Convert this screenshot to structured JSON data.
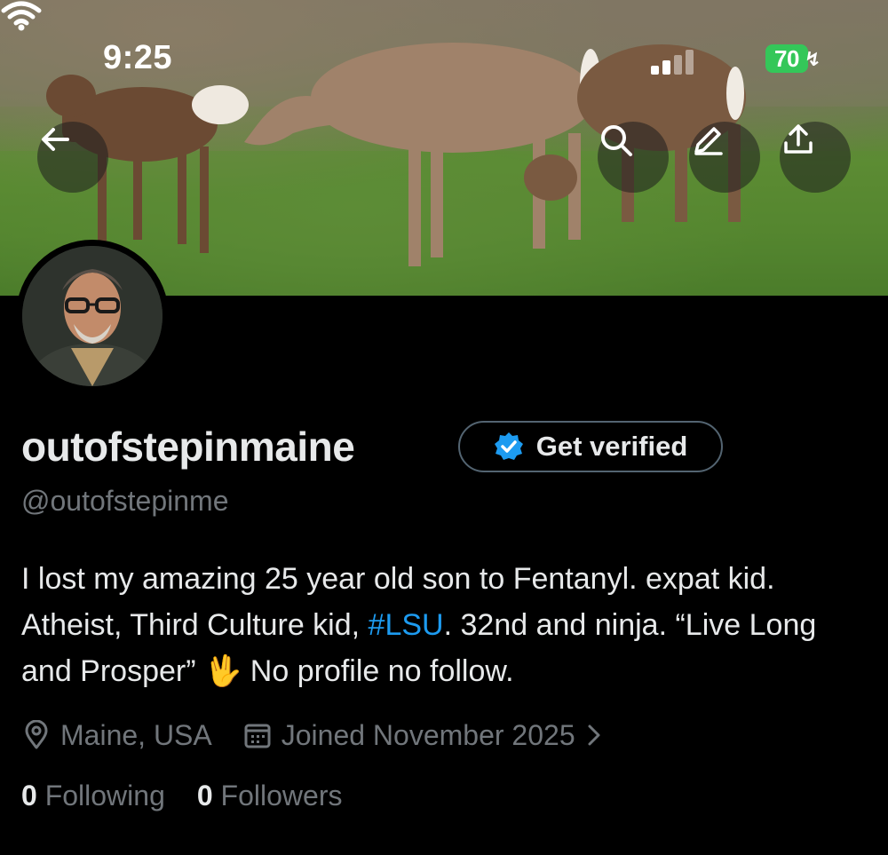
{
  "status_bar": {
    "time": "9:25",
    "battery": "70"
  },
  "header_actions": {
    "back": "arrow-left-icon",
    "search": "search-icon",
    "edit": "pencil-icon",
    "share": "share-icon"
  },
  "profile": {
    "display_name": "outofstepinmaine",
    "verify_button_label": "Get verified",
    "handle": "@outofstepinme",
    "bio": {
      "part1": "I lost my amazing 25 year old son to Fentanyl. expat kid. Atheist, Third Culture kid, ",
      "hashtag": "#LSU",
      "part2": ". 32nd and ninja. “Live Long and Prosper” ",
      "emoji": "🖖",
      "part3": " No profile no follow."
    },
    "location": "Maine, USA",
    "joined": "Joined November 2025",
    "following_count": "0",
    "following_label": "Following",
    "followers_count": "0",
    "followers_label": "Followers"
  },
  "colors": {
    "background": "#000000",
    "text_primary": "#e7e9ea",
    "text_secondary": "#71767b",
    "accent": "#1d9bf0",
    "battery": "#34c759"
  }
}
